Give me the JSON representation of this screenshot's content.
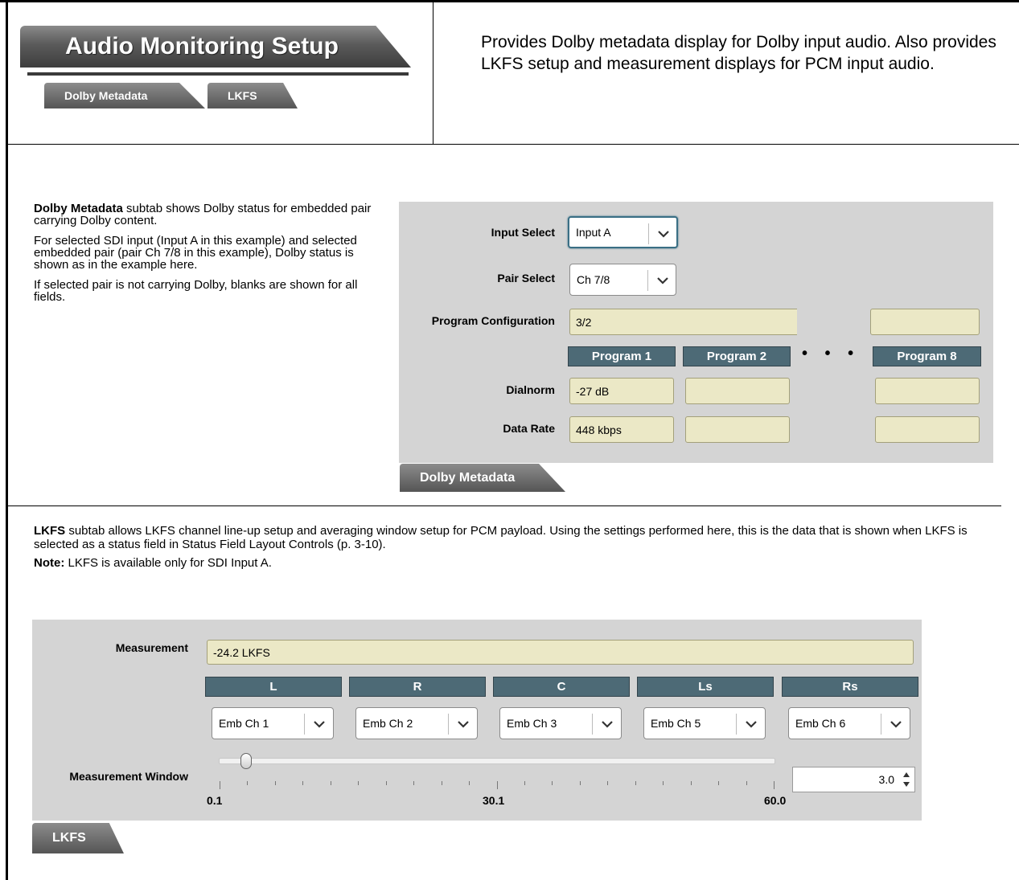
{
  "header": {
    "title": "Audio Monitoring Setup",
    "subtabs": [
      "Dolby Metadata",
      "LKFS"
    ],
    "description": "Provides Dolby metadata display for Dolby input audio. Also provides LKFS setup and measurement displays for PCM input audio."
  },
  "dolby_text": {
    "p1_bold": "Dolby Metadata",
    "p1_rest": " subtab shows Dolby status for embedded pair carrying Dolby content.",
    "p2": "For selected SDI input (Input A in this example) and selected embedded pair (pair Ch 7/8 in this example), Dolby status is shown as in the example here.",
    "p3": "If selected pair is not carrying Dolby, blanks are shown for all fields."
  },
  "dolby_panel": {
    "input_select_label": "Input Select",
    "input_select_value": "Input A",
    "pair_select_label": "Pair Select",
    "pair_select_value": "Ch 7/8",
    "program_config_label": "Program Configuration",
    "program_config_value": "3/2",
    "program_config_value_8": "",
    "programs": [
      "Program 1",
      "Program 2",
      "Program 8"
    ],
    "dots": "• • •",
    "dialnorm_label": "Dialnorm",
    "dialnorm_values": [
      "-27 dB",
      "",
      ""
    ],
    "data_rate_label": "Data Rate",
    "data_rate_values": [
      "448 kbps",
      "",
      ""
    ],
    "tab_label": "Dolby Metadata"
  },
  "lkfs_text": {
    "p1_bold": "LKFS",
    "p1_rest": " subtab allows LKFS channel line-up setup and averaging window setup for PCM payload. Using the settings performed here, this is the data that is shown when LKFS is selected as a status field in Status Field Layout Controls (p. 3-10).",
    "note_bold": "Note:",
    "note_rest": " LKFS is available only for SDI Input A."
  },
  "lkfs_panel": {
    "measurement_label": "Measurement",
    "measurement_value": "-24.2 LKFS",
    "channels": [
      {
        "header": "L",
        "select": "Emb Ch 1"
      },
      {
        "header": "R",
        "select": "Emb Ch 2"
      },
      {
        "header": "C",
        "select": "Emb Ch 3"
      },
      {
        "header": "Ls",
        "select": "Emb Ch 5"
      },
      {
        "header": "Rs",
        "select": "Emb Ch 6"
      }
    ],
    "window_label": "Measurement Window",
    "slider_min": "0.1",
    "slider_mid": "30.1",
    "slider_max": "60.0",
    "slider_value": 3.0,
    "spin_value": "3.0",
    "tab_label": "LKFS"
  },
  "colors": {
    "field_bg": "#ebe8c6",
    "header_bg": "#4d6a76",
    "panel_bg": "#d4d4d4"
  }
}
